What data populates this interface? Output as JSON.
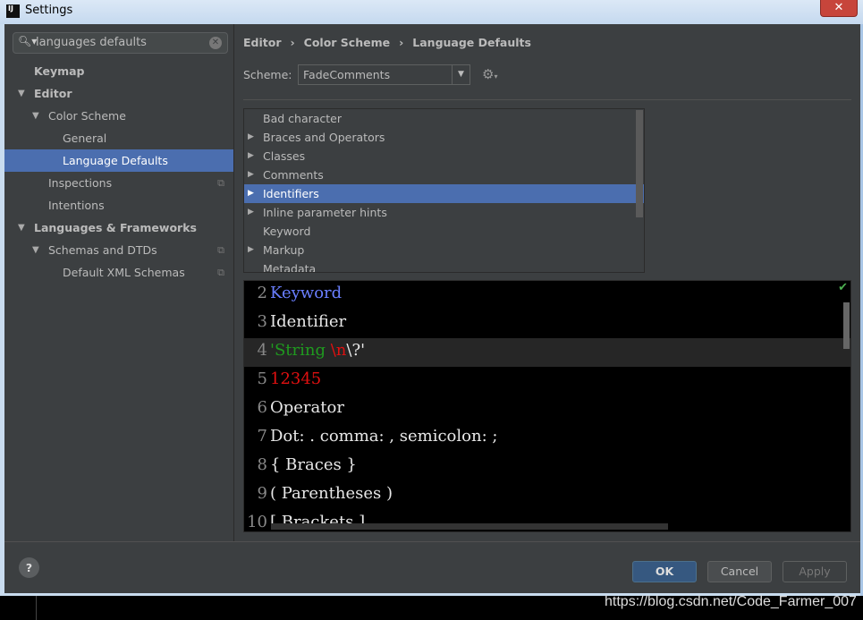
{
  "window": {
    "title": "Settings",
    "close": "✕"
  },
  "search": {
    "value": "languages defaults"
  },
  "sidebar": {
    "items": [
      {
        "label": "Keymap"
      },
      {
        "label": "Editor"
      },
      {
        "label": "Color Scheme"
      },
      {
        "label": "General"
      },
      {
        "label": "Language Defaults"
      },
      {
        "label": "Inspections"
      },
      {
        "label": "Intentions"
      },
      {
        "label": "Languages & Frameworks"
      },
      {
        "label": "Schemas and DTDs"
      },
      {
        "label": "Default XML Schemas"
      }
    ]
  },
  "breadcrumb": [
    "Editor",
    "›",
    "Color Scheme",
    "›",
    "Language Defaults"
  ],
  "scheme": {
    "label": "Scheme:",
    "value": "FadeComments"
  },
  "attributes": [
    "Bad character",
    "Braces and Operators",
    "Classes",
    "Comments",
    "Identifiers",
    "Inline parameter hints",
    "Keyword",
    "Markup",
    "Metadata"
  ],
  "selected_attribute": "Identifiers",
  "preview": {
    "lines": [
      {
        "n": "2",
        "parts": [
          "Keyword"
        ]
      },
      {
        "n": "3",
        "parts": [
          "Identifier"
        ]
      },
      {
        "n": "4",
        "parts": [
          "'String",
          "\\n",
          "\\?'"
        ]
      },
      {
        "n": "5",
        "parts": [
          "12345"
        ]
      },
      {
        "n": "6",
        "parts": [
          "Operator"
        ]
      },
      {
        "n": "7",
        "parts": [
          "Dot: . comma: , semicolon: ;"
        ]
      },
      {
        "n": "8",
        "parts": [
          "{ Braces }"
        ]
      },
      {
        "n": "9",
        "parts": [
          "( Parentheses )"
        ]
      },
      {
        "n": "10",
        "parts": [
          "[ Brackets ]"
        ]
      }
    ]
  },
  "buttons": {
    "ok": "OK",
    "cancel": "Cancel",
    "apply": "Apply",
    "help": "?"
  },
  "watermark": "https://blog.csdn.net/Code_Farmer_007",
  "colors": {
    "selection": "#4b6eaf",
    "keyword": "#6a7fff",
    "string": "#1f9a1f",
    "number": "#e01010"
  }
}
